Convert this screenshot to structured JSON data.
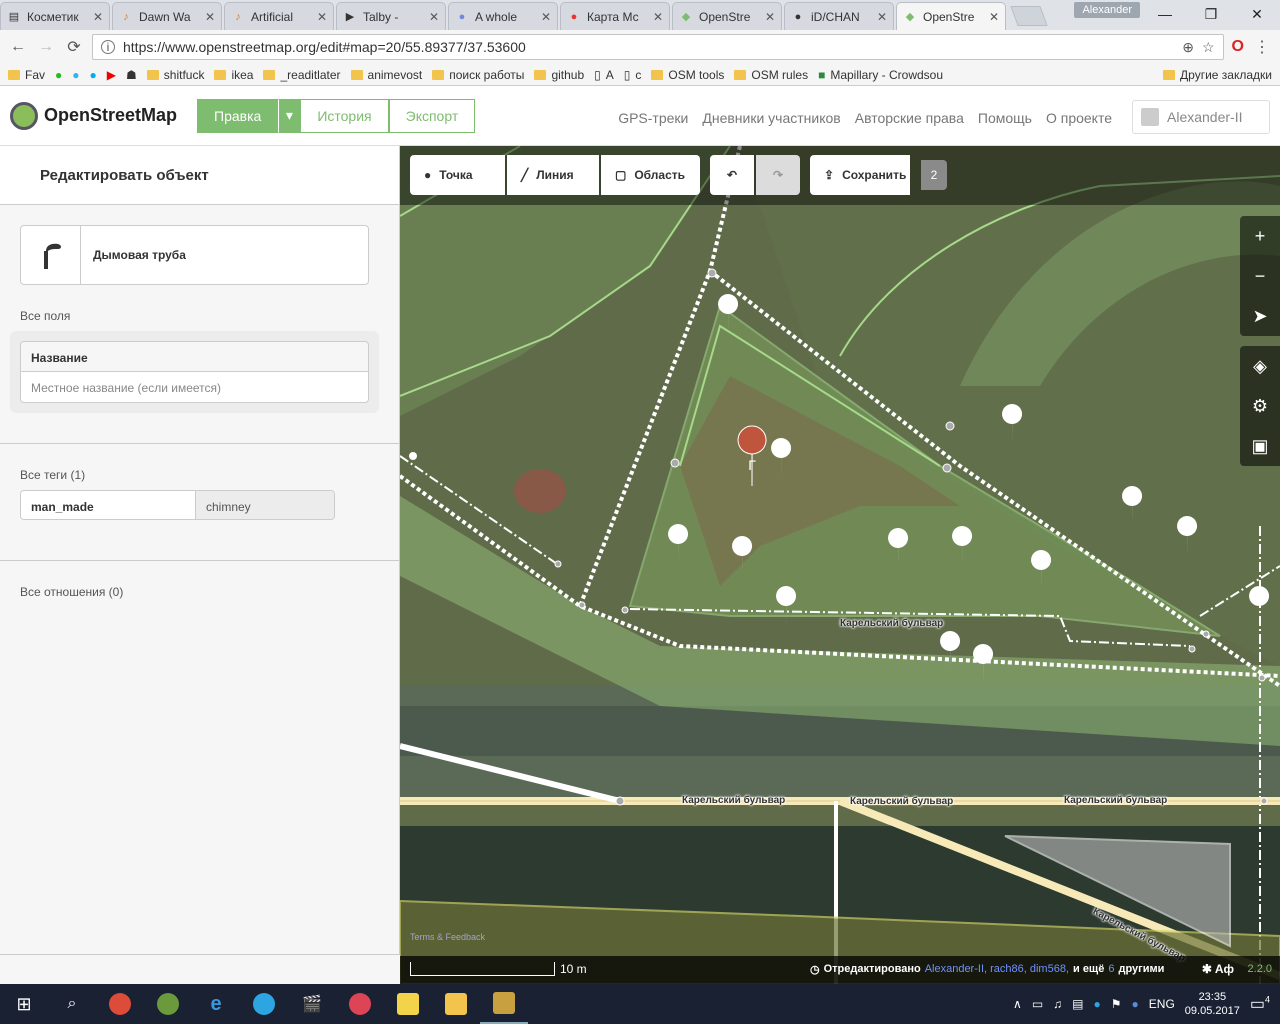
{
  "browser": {
    "tabs": [
      {
        "title": "Косметик",
        "icon": "doc"
      },
      {
        "title": "Dawn Wa",
        "icon": "music"
      },
      {
        "title": "Artificial",
        "icon": "music"
      },
      {
        "title": "Talby -",
        "icon": "play"
      },
      {
        "title": "A whole",
        "icon": "discord"
      },
      {
        "title": "Карта Мс",
        "icon": "map-pin"
      },
      {
        "title": "OpenStre",
        "icon": "osm"
      },
      {
        "title": "iD/CHAN",
        "icon": "github"
      },
      {
        "title": "OpenStre",
        "icon": "osm"
      }
    ],
    "profile": "Alexander",
    "url": "https://www.openstreetmap.org/edit#map=20/55.89377/37.53600",
    "bookmarks": [
      "Fav",
      "shitfuck",
      "ikea",
      "_readitlater",
      "animevost",
      "поиск работы",
      "github",
      "A",
      "c",
      "OSM tools",
      "OSM rules",
      "Mapillary - Crowdsou",
      "Другие закладки"
    ]
  },
  "header": {
    "brand": "OpenStreetMap",
    "edit": "Правка",
    "history": "История",
    "export": "Экспорт",
    "links": [
      "GPS-треки",
      "Дневники участников",
      "Авторские права",
      "Помощь",
      "О проекте"
    ],
    "user": "Alexander-II"
  },
  "sidebar": {
    "title": "Редактировать объект",
    "preset": "Дымовая труба",
    "all_fields": "Все поля",
    "field_label": "Название",
    "field_placeholder": "Местное название (если имеется)",
    "all_tags": "Все теги (1)",
    "tag_key": "man_made",
    "tag_value": "chimney",
    "all_relations": "Все отношения (0)"
  },
  "map": {
    "toolbar": {
      "point": "Точка",
      "line": "Линия",
      "area": "Область",
      "save": "Сохранить",
      "count": "2"
    },
    "street_labels": [
      "Карельский бульвар",
      "Карельский бульвар",
      "Карельский бульвар",
      "Карельский бульвар",
      "Карельский бульвар"
    ],
    "terms": "Terms & Feedback",
    "scale": "10 m",
    "edited_by_prefix": "Отредактировано",
    "editors": "Alexander-II, rach86, dim568,",
    "and_more": "и ещё",
    "more_count": "6",
    "others": "другими",
    "lang": "Aф",
    "version": "2.2.0"
  },
  "taskbar": {
    "lang": "ENG",
    "time": "23:35",
    "date": "09.05.2017",
    "notifications": "4"
  }
}
